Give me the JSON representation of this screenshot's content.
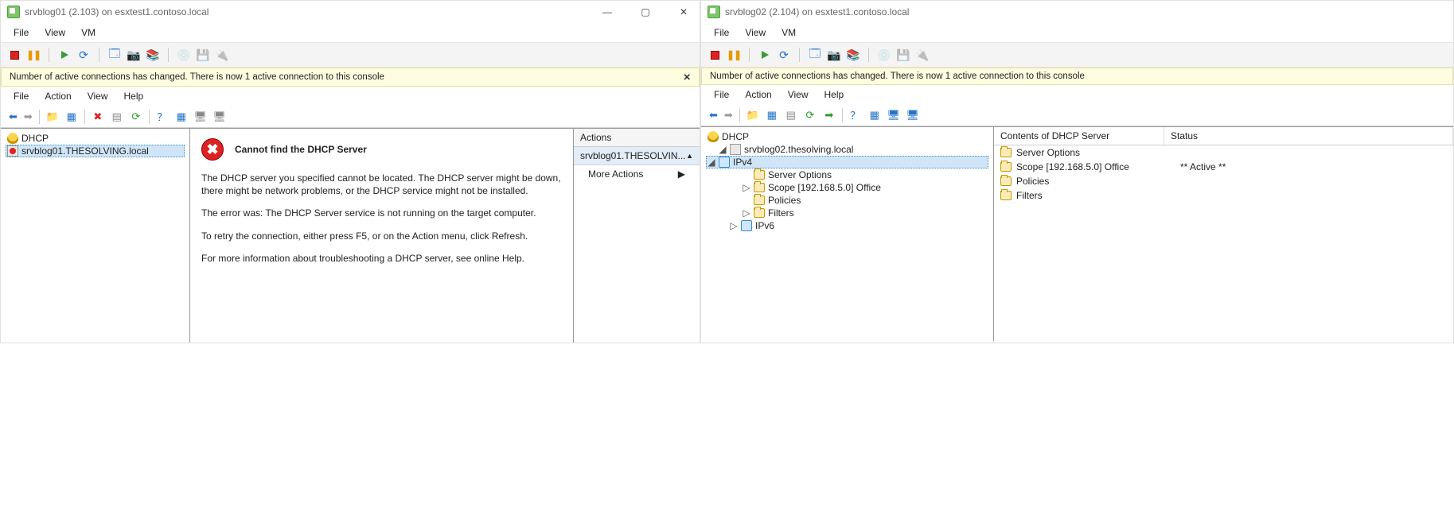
{
  "left": {
    "title": "srvblog01 (2.103) on esxtest1.contoso.local",
    "menus": [
      "File",
      "View",
      "VM"
    ],
    "banner": "Number of active connections has changed. There is now 1 active connection to this console",
    "mmc_menus": [
      "File",
      "Action",
      "View",
      "Help"
    ],
    "tree": {
      "root": "DHCP",
      "server": "srvblog01.THESOLVING.local"
    },
    "error": {
      "title": "Cannot find the DHCP Server",
      "p1": "The DHCP server you specified cannot be located. The DHCP server might be down, there might be network problems, or the DHCP service might not be installed.",
      "p2": "The error was:  The DHCP Server service is not running on the target computer.",
      "p3": "To retry the connection, either press F5, or on the Action menu, click Refresh.",
      "p4": "For more information about troubleshooting a DHCP server, see online Help."
    },
    "actions": {
      "header": "Actions",
      "selected": "srvblog01.THESOLVIN...",
      "more": "More Actions"
    }
  },
  "right": {
    "title": "srvblog02 (2.104) on esxtest1.contoso.local",
    "menus": [
      "File",
      "View",
      "VM"
    ],
    "banner": "Number of active connections has changed. There is now 1 active connection to this console",
    "mmc_menus": [
      "File",
      "Action",
      "View",
      "Help"
    ],
    "tree": {
      "root": "DHCP",
      "server": "srvblog02.thesolving.local",
      "ipv4": "IPv4",
      "children": [
        "Server Options",
        "Scope [192.168.5.0] Office",
        "Policies",
        "Filters"
      ],
      "ipv6": "IPv6"
    },
    "list": {
      "col1": "Contents of DHCP Server",
      "col2": "Status",
      "rows": [
        {
          "name": "Server Options",
          "status": ""
        },
        {
          "name": "Scope [192.168.5.0] Office",
          "status": "** Active **"
        },
        {
          "name": "Policies",
          "status": ""
        },
        {
          "name": "Filters",
          "status": ""
        }
      ]
    }
  }
}
